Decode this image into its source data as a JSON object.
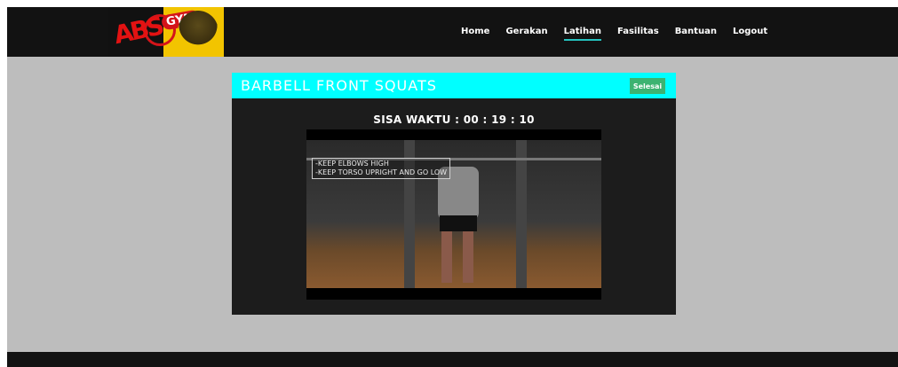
{
  "nav": {
    "items": [
      {
        "label": "Home",
        "active": false
      },
      {
        "label": "Gerakan",
        "active": false
      },
      {
        "label": "Latihan",
        "active": true
      },
      {
        "label": "Fasilitas",
        "active": false
      },
      {
        "label": "Bantuan",
        "active": false
      },
      {
        "label": "Logout",
        "active": false
      }
    ]
  },
  "logo": {
    "text_left": "ABS",
    "text_badge": "GYM"
  },
  "exercise": {
    "title": "BARBELL FRONT SQUATS",
    "finish_button": "Selesai",
    "timer": "SISA WAKTU : 00 : 19 : 10",
    "video_caption": [
      "-KEEP ELBOWS HIGH",
      "-KEEP TORSO UPRIGHT AND GO LOW"
    ]
  },
  "colors": {
    "navbar": "#121212",
    "header_accent": "#00ffff",
    "finish_button": "#3cb371",
    "active_underline": "#25c2bf",
    "page_bg": "#bdbdbd",
    "panel_bg": "#1c1c1c"
  }
}
